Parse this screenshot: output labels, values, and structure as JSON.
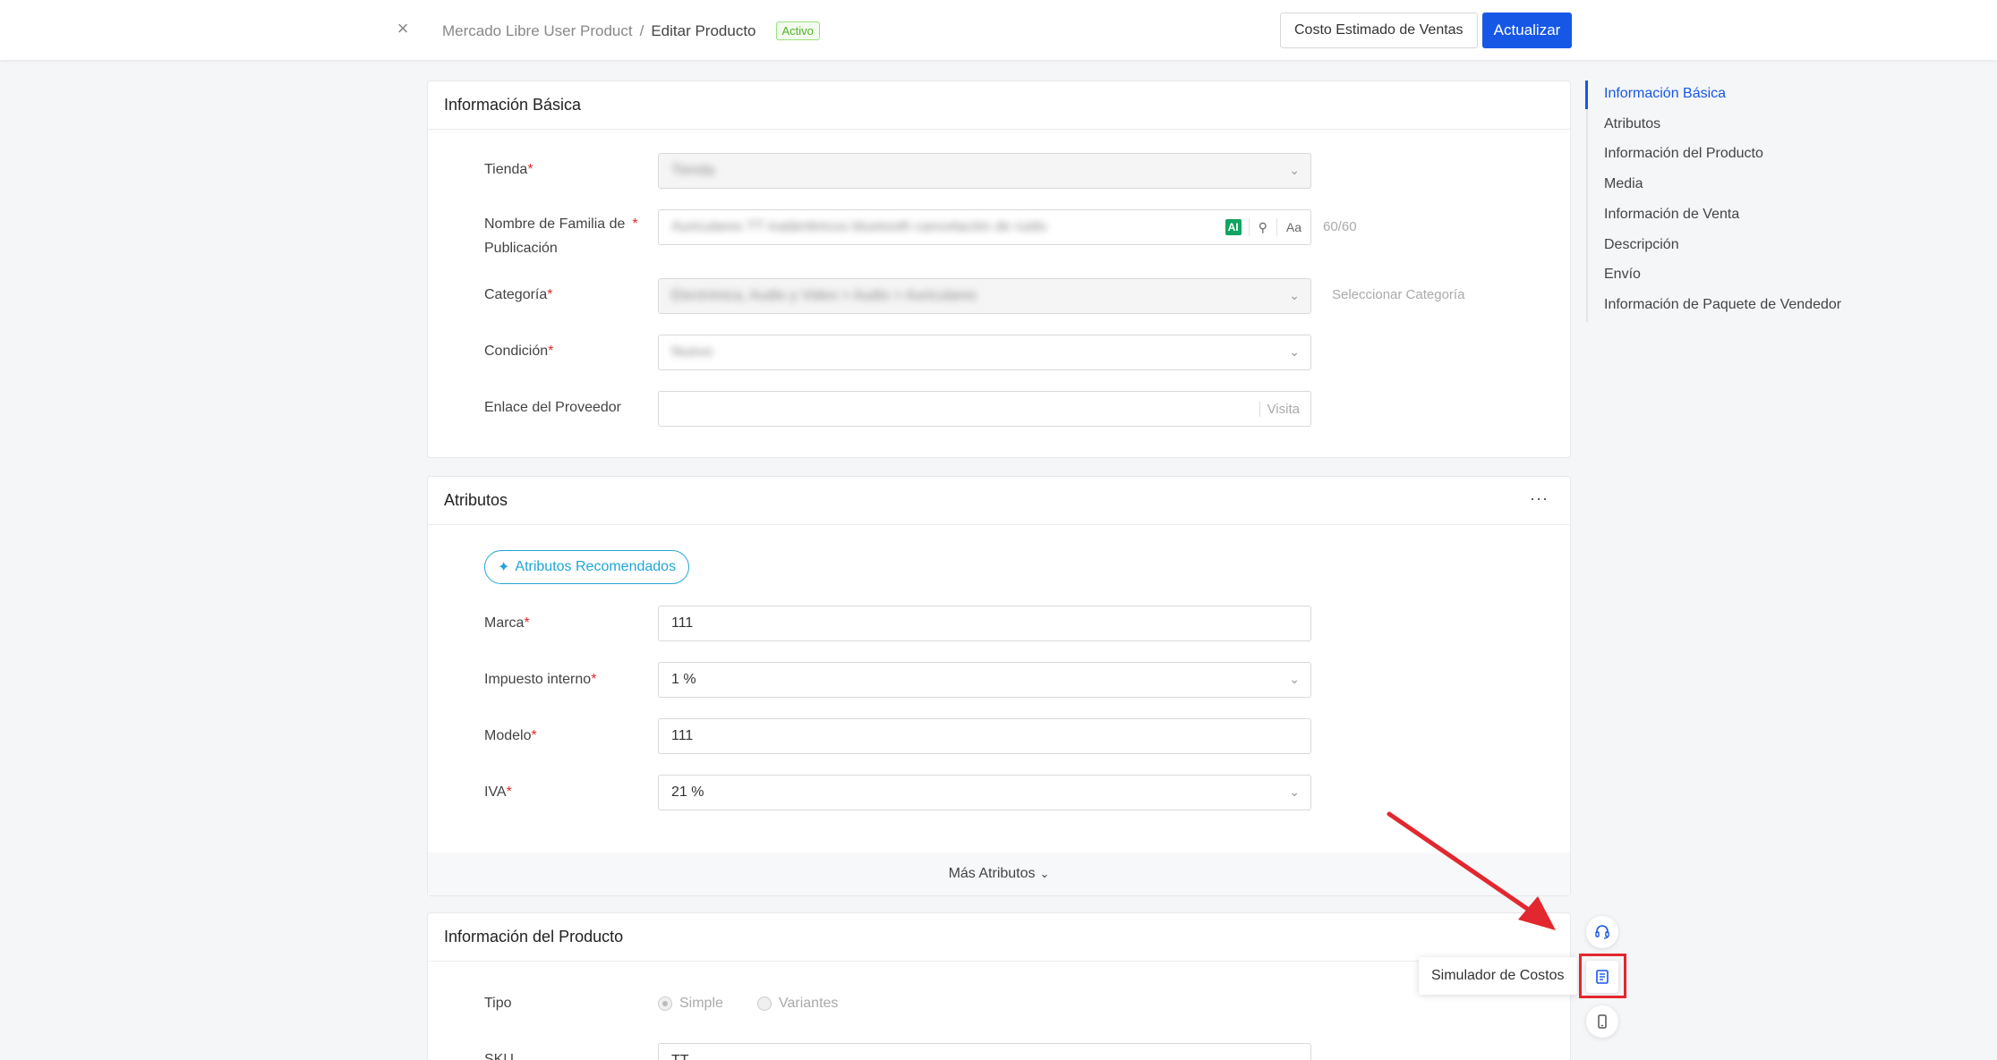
{
  "header": {
    "breadcrumb": [
      "Mercado Libre User Product",
      "Editar Producto"
    ],
    "separator": "/",
    "status_badge": "Activo",
    "cost_button": "Costo Estimado de Ventas",
    "update_button": "Actualizar"
  },
  "basic_info": {
    "title": "Información Básica",
    "fields": {
      "store_label": "Tienda",
      "family_label_line1": "Nombre de Familia de",
      "family_label_line2": "Publicación",
      "family_counter": "60/60",
      "family_value_blurred": "Auriculares TT inalámbricos bluetooth cancelación de ruido",
      "ai_badge": "AI",
      "aa_button": "Aa",
      "category_label": "Categoría",
      "category_value_blurred": "Electrónica, Audio y Video > Audio > Auriculares",
      "category_link": "Seleccionar Categoría",
      "condition_label": "Condición",
      "condition_value_blurred": "Nuevo",
      "store_value_blurred": "Tienda",
      "supplier_label": "Enlace del Proveedor",
      "supplier_visit": "Visita"
    }
  },
  "attributes": {
    "title": "Atributos",
    "more_menu": "···",
    "recommended_button": "Atributos Recomendados",
    "fields": [
      {
        "label": "Marca",
        "value": "111"
      },
      {
        "label": "Impuesto interno",
        "value": "1 %"
      },
      {
        "label": "Modelo",
        "value": "111"
      },
      {
        "label": "IVA",
        "value": "21 %"
      }
    ],
    "more_link": "Más Atributos"
  },
  "product_info": {
    "title": "Información del Producto",
    "type_label": "Tipo",
    "type_options": [
      "Simple",
      "Variantes"
    ],
    "selected_type": "Simple",
    "sku_label": "SKU",
    "sku_value": "TT"
  },
  "anchor_nav": {
    "items": [
      "Información Básica",
      "Atributos",
      "Información del Producto",
      "Media",
      "Información de Venta",
      "Descripción",
      "Envío",
      "Información de Paquete de Vendedor"
    ],
    "active": "Información Básica"
  },
  "floating": {
    "tooltip": "Simulador de Costos",
    "icons": [
      "headset-icon",
      "calculator-icon",
      "mobile-icon"
    ]
  },
  "colors": {
    "primary": "#1657e6",
    "annotation_red": "#e3272e",
    "active_badge": "#52b128"
  }
}
